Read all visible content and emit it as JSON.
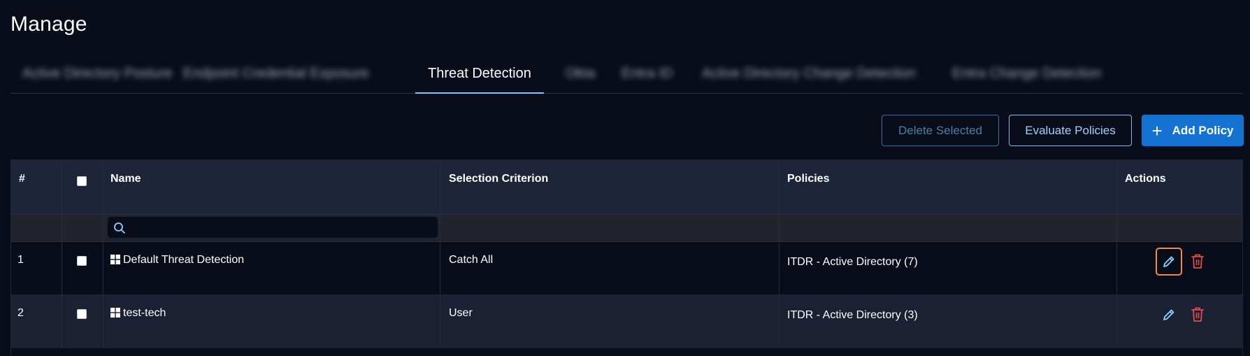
{
  "page": {
    "title": "Manage"
  },
  "tabs": [
    {
      "label": "Active Directory Posture",
      "blurred": true
    },
    {
      "label": "Endpoint Credential Exposure",
      "blurred": true
    },
    {
      "label": "Threat Detection",
      "active": true
    },
    {
      "label": "Okta",
      "blurred": true
    },
    {
      "label": "Entra ID",
      "blurred": true
    },
    {
      "label": "Active Directory Change Detection",
      "blurred": true
    },
    {
      "label": "Entra Change Detection",
      "blurred": true
    }
  ],
  "toolbar": {
    "delete_label": "Delete Selected",
    "evaluate_label": "Evaluate Policies",
    "add_label": "Add Policy"
  },
  "table": {
    "headers": {
      "index": "#",
      "name": "Name",
      "criterion": "Selection Criterion",
      "policies": "Policies",
      "actions": "Actions"
    },
    "search": {
      "value": "",
      "placeholder": ""
    },
    "rows": [
      {
        "index": "1",
        "name": "Default Threat Detection",
        "criterion": "Catch All",
        "policies": "ITDR - Active Directory (7)",
        "os_icon": "windows-icon"
      },
      {
        "index": "2",
        "name": "test-tech",
        "criterion": "User",
        "policies": "ITDR - Active Directory (3)",
        "os_icon": "windows-icon"
      }
    ]
  },
  "colors": {
    "background": "#090d1a",
    "header_bg": "#1f2538",
    "accent": "#1473d1",
    "tab_underline": "#7ec8ff",
    "edit_icon": "#8fd0ff",
    "delete_icon": "#e24b4b",
    "focus_ring": "#f08a4b"
  }
}
